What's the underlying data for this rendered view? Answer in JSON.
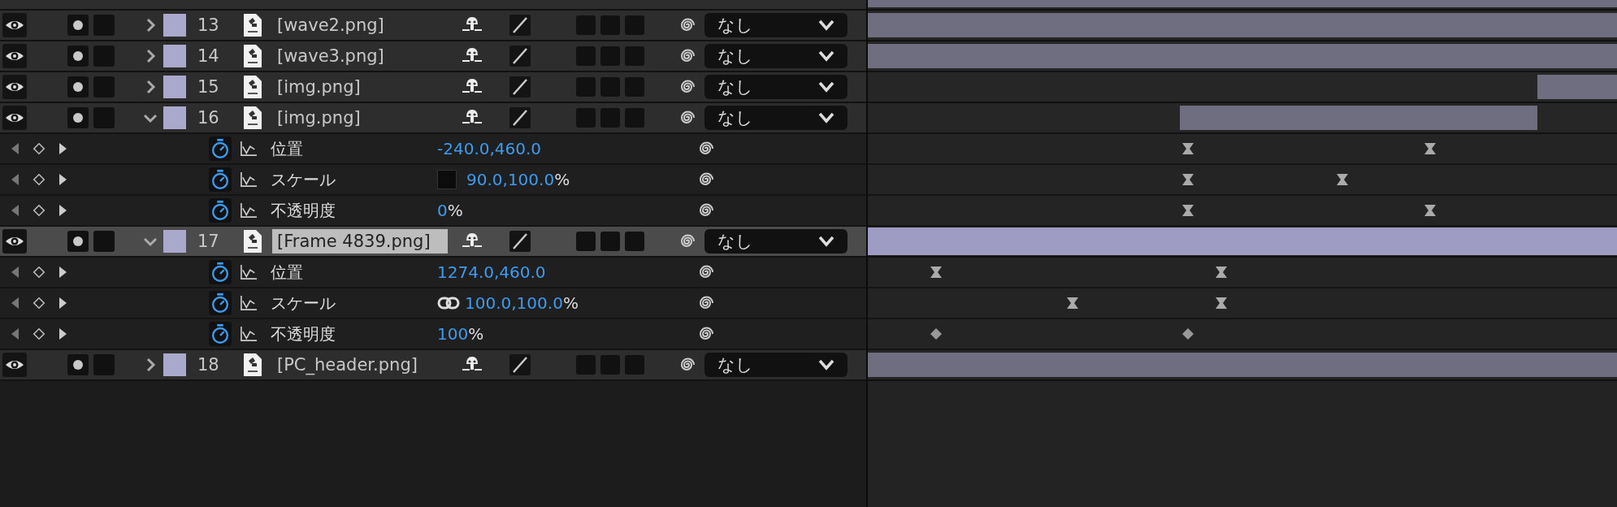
{
  "layers": [
    {
      "number": "13",
      "name": "[wave2.png]",
      "expanded": false,
      "selected": false,
      "parent": "なし"
    },
    {
      "number": "14",
      "name": "[wave3.png]",
      "expanded": false,
      "selected": false,
      "parent": "なし"
    },
    {
      "number": "15",
      "name": "[img.png]",
      "expanded": false,
      "selected": false,
      "parent": "なし"
    },
    {
      "number": "16",
      "name": "[img.png]",
      "expanded": true,
      "selected": false,
      "parent": "なし",
      "properties": [
        {
          "name": "位置",
          "value": "-240.0,460.0",
          "keyframes": [
            {
              "kind": "hourglass"
            },
            {
              "kind": "hourglass"
            }
          ]
        },
        {
          "kind": "scale",
          "name": "スケール",
          "value": "90.0,100.0",
          "unit": "%",
          "linked": false,
          "keyframes": [
            {
              "kind": "hourglass"
            },
            {
              "kind": "hourglass"
            }
          ]
        },
        {
          "name": "不透明度",
          "value": "0",
          "unit": "%",
          "keyframes": [
            {
              "kind": "hourglass"
            },
            {
              "kind": "hourglass"
            }
          ]
        }
      ]
    },
    {
      "number": "17",
      "name": "[Frame 4839.png]",
      "expanded": true,
      "selected": true,
      "parent": "なし",
      "properties": [
        {
          "name": "位置",
          "value": "1274.0,460.0",
          "keyframes": [
            {
              "kind": "hourglass"
            },
            {
              "kind": "hourglass"
            }
          ]
        },
        {
          "kind": "scale",
          "name": "スケール",
          "value": "100.0,100.0",
          "unit": "%",
          "linked": true,
          "keyframes": [
            {
              "kind": "hourglass"
            },
            {
              "kind": "hourglass"
            }
          ]
        },
        {
          "name": "不透明度",
          "value": "100",
          "unit": "%",
          "keyframes": [
            {
              "kind": "diamond"
            },
            {
              "kind": "diamond"
            }
          ]
        }
      ]
    },
    {
      "number": "18",
      "name": "[PC_header.png]",
      "expanded": false,
      "selected": false,
      "parent": "なし"
    }
  ]
}
